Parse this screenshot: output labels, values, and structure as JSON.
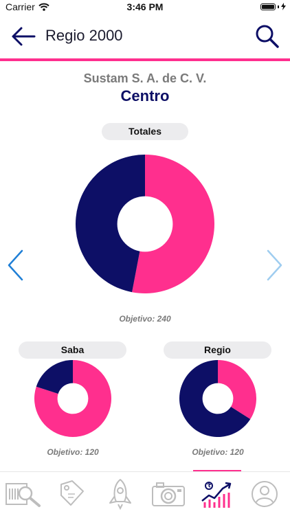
{
  "status": {
    "carrier": "Carrier",
    "time": "3:46 PM"
  },
  "header": {
    "title": "Regio 2000"
  },
  "company": "Sustam S. A. de C. V.",
  "region": "Centro",
  "colors": {
    "accent": "#ff2f8e",
    "navy": "#0d0f66",
    "pill": "#ececee"
  },
  "chart_data": [
    {
      "type": "pie",
      "title": "Totales",
      "values": [
        {
          "color": "#ff2f8e",
          "value": 53
        },
        {
          "color": "#0d0f66",
          "value": 47
        }
      ],
      "objective_text": "Objetivo: 240"
    },
    {
      "type": "pie",
      "title": "Saba",
      "values": [
        {
          "color": "#ff2f8e",
          "value": 80
        },
        {
          "color": "#0d0f66",
          "value": 20
        }
      ],
      "objective_text": "Objetivo: 120"
    },
    {
      "type": "pie",
      "title": "Regio",
      "values": [
        {
          "color": "#ff2f8e",
          "value": 34
        },
        {
          "color": "#0d0f66",
          "value": 66
        }
      ],
      "objective_text": "Objetivo: 120"
    }
  ],
  "tabs": [
    {
      "icon": "report-search-icon"
    },
    {
      "icon": "price-tag-icon"
    },
    {
      "icon": "rocket-icon"
    },
    {
      "icon": "camera-icon"
    },
    {
      "icon": "sales-chart-icon",
      "active": true
    },
    {
      "icon": "profile-icon"
    }
  ]
}
